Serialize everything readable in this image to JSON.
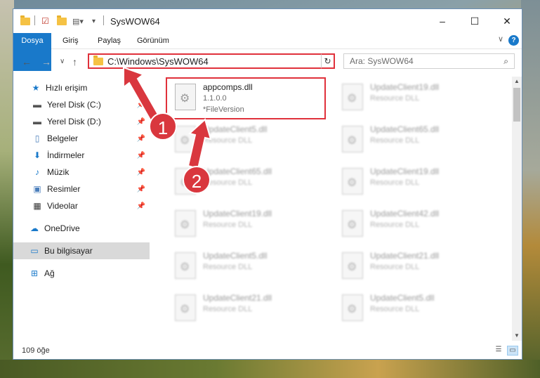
{
  "window": {
    "title": "SysWOW64",
    "controls": {
      "minimize": "–",
      "maximize": "☐",
      "close": "✕"
    }
  },
  "ribbon": {
    "tabs": [
      {
        "label": "Dosya"
      },
      {
        "label": "Giriş"
      },
      {
        "label": "Paylaş"
      },
      {
        "label": "Görünüm"
      }
    ],
    "help": "?",
    "collapse": "∨"
  },
  "address": {
    "path": "C:\\Windows\\SysWOW64",
    "dropdown": "∨",
    "refresh": "↻"
  },
  "search": {
    "placeholder": "Ara: SysWOW64",
    "icon": "⌕"
  },
  "nav_buttons": {
    "back": "←",
    "forward": "→",
    "recent": "∨",
    "up": "↑"
  },
  "sidebar": {
    "quick_access": "Hızlı erişim",
    "items": [
      {
        "label": "Yerel Disk (C:)",
        "icon": "drive-c-icon"
      },
      {
        "label": "Yerel Disk (D:)",
        "icon": "drive-d-icon"
      },
      {
        "label": "Belgeler",
        "icon": "documents-icon"
      },
      {
        "label": "İndirmeler",
        "icon": "downloads-icon"
      },
      {
        "label": "Müzik",
        "icon": "music-icon"
      },
      {
        "label": "Resimler",
        "icon": "pictures-icon"
      },
      {
        "label": "Videolar",
        "icon": "videos-icon"
      }
    ],
    "onedrive": "OneDrive",
    "this_pc": "Bu bilgisayar",
    "network": "Ağ"
  },
  "files": {
    "main": {
      "name": "appcomps.dll",
      "version": "1.1.0.0",
      "description": "*FileVersion"
    },
    "blurred_left": [
      {
        "name": "UpdateClient5.dll",
        "description": "Resource DLL"
      },
      {
        "name": "UpdateClient65.dll",
        "description": "Resource DLL"
      },
      {
        "name": "UpdateClient19.dll",
        "description": "Resource DLL"
      },
      {
        "name": "UpdateClient5.dll",
        "description": "Resource DLL"
      },
      {
        "name": "UpdateClient21.dll",
        "description": "Resource DLL"
      }
    ],
    "blurred_right": [
      {
        "name": "UpdateClient19.dll",
        "description": "Resource DLL"
      },
      {
        "name": "UpdateClient65.dll",
        "description": "Resource DLL"
      },
      {
        "name": "UpdateClient19.dll",
        "description": "Resource DLL"
      },
      {
        "name": "UpdateClient42.dll",
        "description": "Resource DLL"
      },
      {
        "name": "UpdateClient21.dll",
        "description": "Resource DLL"
      },
      {
        "name": "UpdateClient5.dll",
        "description": "Resource DLL"
      }
    ]
  },
  "status": {
    "count": "109 öğe"
  },
  "annotations": {
    "step1": "1",
    "step2": "2",
    "color": "#d9373e"
  }
}
